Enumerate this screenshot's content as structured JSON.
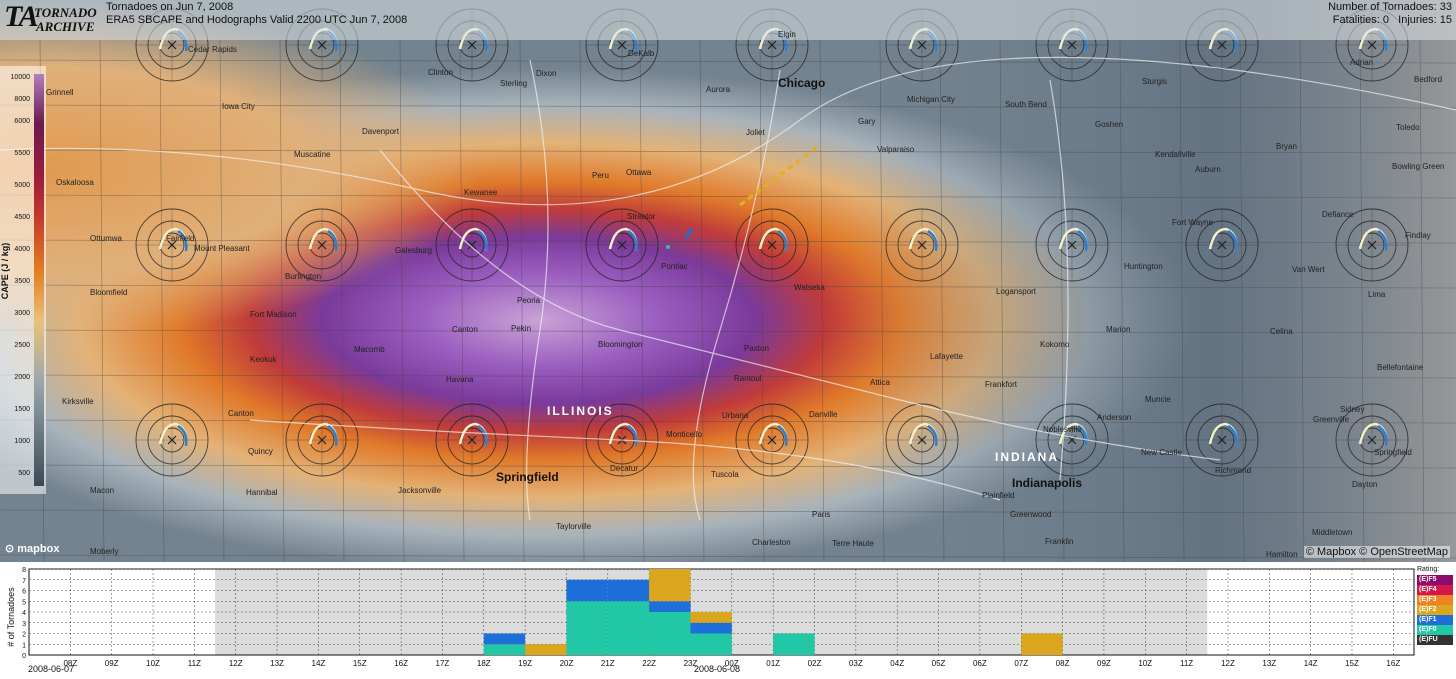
{
  "header": {
    "logo_ta": "TA",
    "logo_word1": "TORNADO",
    "logo_word2": "ARCHIVE",
    "title_line1": "Tornadoes on Jun 7, 2008",
    "title_line2": "ERA5 SBCAPE and Hodographs Valid 2200 UTC Jun 7, 2008",
    "stats_line1": "Number of Tornadoes: 33",
    "stats_line2": "Fatalities: 0   Injuries: 15"
  },
  "colorbar": {
    "label": "CAPE (J / kg)",
    "ticks": [
      "10000",
      "8000",
      "6000",
      "5500",
      "5000",
      "4500",
      "4000",
      "3500",
      "3000",
      "2500",
      "2000",
      "1500",
      "1000",
      "500"
    ]
  },
  "map": {
    "cities": [
      {
        "name": "Cedar Rapids",
        "big": false
      },
      {
        "name": "Iowa City",
        "big": false
      },
      {
        "name": "Davenport",
        "big": false
      },
      {
        "name": "Muscatine",
        "big": false
      },
      {
        "name": "Oskaloosa",
        "big": false
      },
      {
        "name": "Ottumwa",
        "big": false
      },
      {
        "name": "Fairfield",
        "big": false
      },
      {
        "name": "Mount Pleasant",
        "big": false
      },
      {
        "name": "Burlington",
        "big": false
      },
      {
        "name": "Fort Madison",
        "big": false
      },
      {
        "name": "Keokuk",
        "big": false
      },
      {
        "name": "Bloomfield",
        "big": false
      },
      {
        "name": "Galesburg",
        "big": false
      },
      {
        "name": "Kewanee",
        "big": false
      },
      {
        "name": "Macomb",
        "big": false
      },
      {
        "name": "Peoria",
        "big": false
      },
      {
        "name": "Pekin",
        "big": false
      },
      {
        "name": "Canton",
        "big": false
      },
      {
        "name": "Havana",
        "big": false
      },
      {
        "name": "Bloomington",
        "big": false
      },
      {
        "name": "Pontiac",
        "big": false
      },
      {
        "name": "Streator",
        "big": false
      },
      {
        "name": "Ottawa",
        "big": false
      },
      {
        "name": "Peru",
        "big": false
      },
      {
        "name": "Joliet",
        "big": false
      },
      {
        "name": "Chicago",
        "big": true
      },
      {
        "name": "Gary",
        "big": false
      },
      {
        "name": "Valparaiso",
        "big": false
      },
      {
        "name": "Michigan City",
        "big": false
      },
      {
        "name": "South Bend",
        "big": false
      },
      {
        "name": "Goshen",
        "big": false
      },
      {
        "name": "Kendallville",
        "big": false
      },
      {
        "name": "Auburn",
        "big": false
      },
      {
        "name": "Fort Wayne",
        "big": false
      },
      {
        "name": "Huntington",
        "big": false
      },
      {
        "name": "Logansport",
        "big": false
      },
      {
        "name": "Kokomo",
        "big": false
      },
      {
        "name": "Marion",
        "big": false
      },
      {
        "name": "Lafayette",
        "big": false
      },
      {
        "name": "Frankfort",
        "big": false
      },
      {
        "name": "Muncie",
        "big": false
      },
      {
        "name": "Anderson",
        "big": false
      },
      {
        "name": "Noblesville",
        "big": false
      },
      {
        "name": "New Castle",
        "big": false
      },
      {
        "name": "Richmond",
        "big": false
      },
      {
        "name": "Greenville",
        "big": false
      },
      {
        "name": "Indianapolis",
        "big": true
      },
      {
        "name": "Franklin",
        "big": false
      },
      {
        "name": "Terre Haute",
        "big": false
      },
      {
        "name": "Paris",
        "big": false
      },
      {
        "name": "Charleston",
        "big": false
      },
      {
        "name": "Danville",
        "big": false
      },
      {
        "name": "Urbana",
        "big": false
      },
      {
        "name": "Tuscola",
        "big": false
      },
      {
        "name": "Rantoul",
        "big": false
      },
      {
        "name": "Paxton",
        "big": false
      },
      {
        "name": "Watseka",
        "big": false
      },
      {
        "name": "Attica",
        "big": false
      },
      {
        "name": "Monticello",
        "big": false
      },
      {
        "name": "Decatur",
        "big": false
      },
      {
        "name": "Springfield",
        "big": true
      },
      {
        "name": "Jacksonville",
        "big": false
      },
      {
        "name": "Taylorville",
        "big": false
      },
      {
        "name": "Quincy",
        "big": false
      },
      {
        "name": "Hannibal",
        "big": false
      },
      {
        "name": "Canton",
        "big": false
      },
      {
        "name": "Kirksville",
        "big": false
      },
      {
        "name": "Macon",
        "big": false
      },
      {
        "name": "Moberly",
        "big": false
      },
      {
        "name": "Toledo",
        "big": false
      },
      {
        "name": "Bowling Green",
        "big": false
      },
      {
        "name": "Findlay",
        "big": false
      },
      {
        "name": "Lima",
        "big": false
      },
      {
        "name": "Van Wert",
        "big": false
      },
      {
        "name": "Celina",
        "big": false
      },
      {
        "name": "Bellefontaine",
        "big": false
      },
      {
        "name": "Sidney",
        "big": false
      },
      {
        "name": "Springfield",
        "big": false
      },
      {
        "name": "Dayton",
        "big": false
      },
      {
        "name": "Middletown",
        "big": false
      },
      {
        "name": "Hamilton",
        "big": false
      },
      {
        "name": "Defiance",
        "big": false
      },
      {
        "name": "Bryan",
        "big": false
      },
      {
        "name": "Sturgis",
        "big": false
      },
      {
        "name": "Adrian",
        "big": false
      },
      {
        "name": "Bedford",
        "big": false
      },
      {
        "name": "Clinton",
        "big": false
      },
      {
        "name": "Sterling",
        "big": false
      },
      {
        "name": "Dixon",
        "big": false
      },
      {
        "name": "DeKalb",
        "big": false
      },
      {
        "name": "Aurora",
        "big": false
      },
      {
        "name": "Elgin",
        "big": false
      },
      {
        "name": "Greenwood",
        "big": false
      },
      {
        "name": "Plainfield",
        "big": false
      },
      {
        "name": "Grinnell",
        "big": false
      }
    ],
    "states": [
      "ILLINOIS",
      "INDIANA"
    ],
    "mapbox_logo": "mapbox",
    "attribution": "© Mapbox © OpenStreetMap"
  },
  "histogram": {
    "ylabel": "# of Tornadoes",
    "yticks": [
      "0",
      "1",
      "2",
      "3",
      "4",
      "5",
      "6",
      "7",
      "8"
    ],
    "xticks": [
      "08Z",
      "09Z",
      "10Z",
      "11Z",
      "12Z",
      "13Z",
      "14Z",
      "15Z",
      "16Z",
      "17Z",
      "18Z",
      "19Z",
      "20Z",
      "21Z",
      "22Z",
      "23Z",
      "00Z",
      "01Z",
      "02Z",
      "03Z",
      "04Z",
      "05Z",
      "06Z",
      "07Z",
      "08Z",
      "09Z",
      "10Z",
      "11Z",
      "12Z",
      "13Z",
      "14Z",
      "15Z",
      "16Z"
    ],
    "date_left": "2008-06-07",
    "date_mid": "2008-06-08",
    "legend_title": "Rating:",
    "legend": [
      {
        "label": "(E)F5",
        "color": "#8c0b6b"
      },
      {
        "label": "(E)F4",
        "color": "#d4174a"
      },
      {
        "label": "(E)F3",
        "color": "#f08223"
      },
      {
        "label": "(E)F2",
        "color": "#d9a61d"
      },
      {
        "label": "(E)F1",
        "color": "#1f6fd8"
      },
      {
        "label": "(E)F0",
        "color": "#22c7a6"
      },
      {
        "label": "(E)FU",
        "color": "#333333"
      }
    ]
  },
  "chart_data": {
    "type": "bar",
    "title": "",
    "ylabel": "# of Tornadoes",
    "xlabel": "",
    "ylim": [
      0,
      8
    ],
    "categories": [
      "08Z",
      "09Z",
      "10Z",
      "11Z",
      "12Z",
      "13Z",
      "14Z",
      "15Z",
      "16Z",
      "17Z",
      "18Z",
      "19Z",
      "20Z",
      "21Z",
      "22Z",
      "23Z",
      "00Z",
      "01Z",
      "02Z",
      "03Z",
      "04Z",
      "05Z",
      "06Z",
      "07Z",
      "08Z",
      "09Z",
      "10Z",
      "11Z",
      "12Z",
      "13Z",
      "14Z",
      "15Z",
      "16Z"
    ],
    "series": [
      {
        "name": "(E)F0",
        "values": [
          0,
          0,
          0,
          0,
          0,
          0,
          0,
          0,
          0,
          0,
          1,
          0,
          5,
          5,
          4,
          2,
          0,
          2,
          0,
          0,
          0,
          0,
          0,
          0,
          0,
          0,
          0,
          0,
          0,
          0,
          0,
          0,
          0
        ]
      },
      {
        "name": "(E)F1",
        "values": [
          0,
          0,
          0,
          0,
          0,
          0,
          0,
          0,
          0,
          0,
          1,
          0,
          2,
          2,
          1,
          1,
          0,
          0,
          0,
          0,
          0,
          0,
          0,
          0,
          0,
          0,
          0,
          0,
          0,
          0,
          0,
          0,
          0
        ]
      },
      {
        "name": "(E)F2",
        "values": [
          0,
          0,
          0,
          0,
          0,
          0,
          0,
          0,
          0,
          0,
          0,
          1,
          0,
          0,
          3,
          1,
          0,
          0,
          0,
          0,
          0,
          0,
          0,
          2,
          0,
          0,
          0,
          0,
          0,
          0,
          0,
          0,
          0
        ]
      }
    ],
    "shaded_range": [
      "12Z",
      "12Z"
    ],
    "grid": true
  }
}
